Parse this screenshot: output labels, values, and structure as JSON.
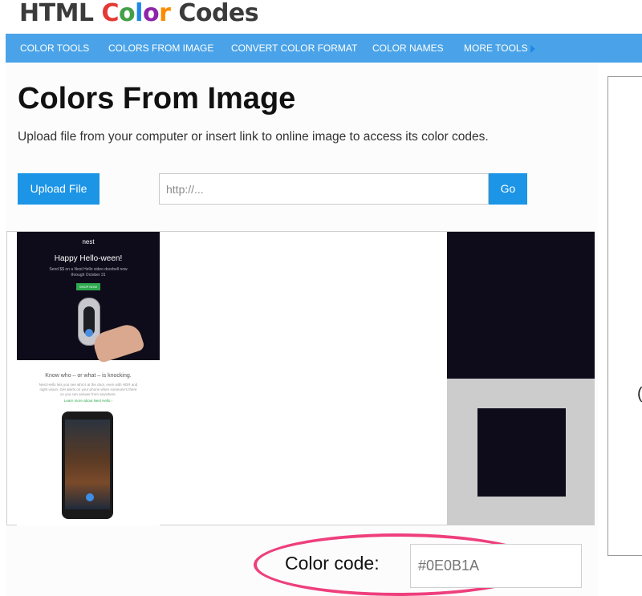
{
  "site": {
    "logo": {
      "word1": "HTML",
      "word2": "Color",
      "word3": "Codes"
    },
    "logo_letter_colors": [
      "#e53935",
      "#43a047",
      "#1e88e5",
      "#8e24aa",
      "#fb8c00"
    ]
  },
  "nav": {
    "items": [
      {
        "label": "Color Tools"
      },
      {
        "label": "Colors From Image"
      },
      {
        "label": "Convert Color Format"
      },
      {
        "label": "Color Names"
      },
      {
        "label": "More Tools"
      }
    ],
    "more_icon": "caret-right-icon",
    "bar_color": "#4aa3e8"
  },
  "main": {
    "title": "Colors From Image",
    "description": "Upload file from your computer or insert link to online image to access its color codes.",
    "upload_label": "Upload File",
    "url_placeholder": "http://...",
    "url_value": "",
    "go_label": "Go",
    "button_color": "#1c95e6"
  },
  "preview": {
    "brand": "nest",
    "headline": "Happy Hello-ween!",
    "sub1": "Send $$ on a Nest Hello video doorbell now",
    "sub2": "through October 31",
    "cta": "SHOP NOW",
    "mid_headline": "Know who – or what – is knocking.",
    "mid_line1": "Nest Hello lets you see who's at the door, even with HDR and",
    "mid_line2": "night vision. Get alerts on your phone when someone's there",
    "mid_line3": "so you can answer from anywhere.",
    "link": "Learn more about Nest Hello ›"
  },
  "picker": {
    "sampled_color": "#0E0B1A",
    "frame_color": "#cccccc",
    "label": "Color code:",
    "value": "#0E0B1A",
    "highlight_color": "#ee3f7c"
  },
  "sidebar": {
    "glyph": "("
  }
}
